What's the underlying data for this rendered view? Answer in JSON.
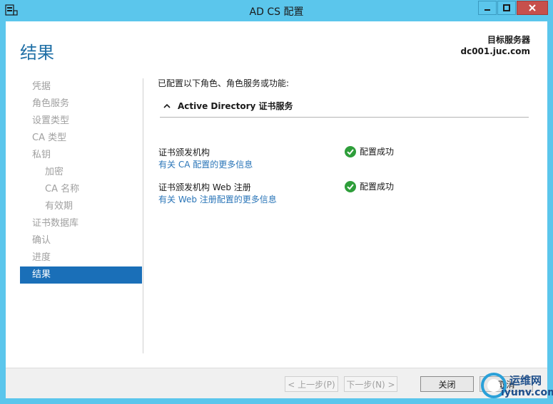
{
  "window": {
    "title": "AD CS 配置",
    "icon": "server-manager-icon"
  },
  "header": {
    "page_title": "结果",
    "target_label": "目标服务器",
    "target_server": "dc001.juc.com"
  },
  "nav": {
    "items": [
      {
        "label": "凭据",
        "level": 0,
        "active": false
      },
      {
        "label": "角色服务",
        "level": 0,
        "active": false
      },
      {
        "label": "设置类型",
        "level": 0,
        "active": false
      },
      {
        "label": "CA 类型",
        "level": 0,
        "active": false
      },
      {
        "label": "私钥",
        "level": 0,
        "active": false
      },
      {
        "label": "加密",
        "level": 1,
        "active": false
      },
      {
        "label": "CA 名称",
        "level": 1,
        "active": false
      },
      {
        "label": "有效期",
        "level": 1,
        "active": false
      },
      {
        "label": "证书数据库",
        "level": 0,
        "active": false
      },
      {
        "label": "确认",
        "level": 0,
        "active": false
      },
      {
        "label": "进度",
        "level": 0,
        "active": false
      },
      {
        "label": "结果",
        "level": 0,
        "active": true
      }
    ]
  },
  "content": {
    "intro": "已配置以下角色、角色服务或功能:",
    "section_title": "Active Directory 证书服务",
    "rows": [
      {
        "name": "证书颁发机构",
        "link": "有关 CA 配置的更多信息",
        "status": "配置成功"
      },
      {
        "name": "证书颁发机构 Web 注册",
        "link": "有关 Web 注册配置的更多信息",
        "status": "配置成功"
      }
    ]
  },
  "footer": {
    "prev": "< 上一步(P)",
    "next": "下一步(N) >",
    "close": "关闭",
    "cancel": "取消"
  },
  "watermark": {
    "line1": "运维网",
    "line2": "iyunv.com"
  },
  "colors": {
    "chrome": "#5bc6ec",
    "accent": "#1a6fb8",
    "link": "#2a75b8",
    "success": "#2e9e3a",
    "close_button": "#c7504c"
  }
}
